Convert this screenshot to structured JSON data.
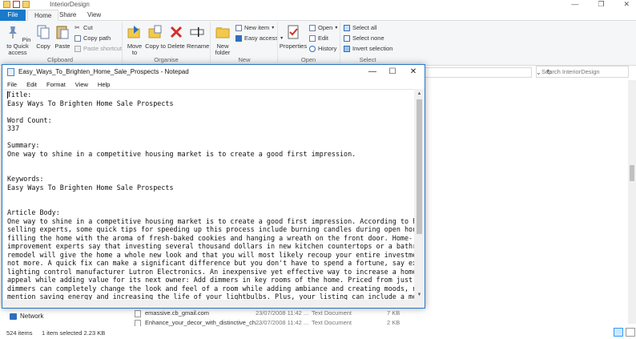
{
  "explorer": {
    "window_title": "InteriorDesign",
    "tabs": [
      "File",
      "Home",
      "Share",
      "View"
    ],
    "ribbon": {
      "clipboard": {
        "pin_label": "Pin to Quick access",
        "copy_label": "Copy",
        "paste_label": "Paste",
        "cut_label": "Cut",
        "copy_path_label": "Copy path",
        "paste_shortcut_label": "Paste shortcut",
        "group_label": "Clipboard"
      },
      "organise": {
        "move_to_label": "Move to",
        "copy_to_label": "Copy to",
        "delete_label": "Delete",
        "rename_label": "Rename",
        "group_label": "Organise"
      },
      "new": {
        "new_folder_label": "New folder",
        "new_item_label": "New item",
        "easy_access_label": "Easy access",
        "group_label": "New"
      },
      "open": {
        "properties_label": "Properties",
        "open_label": "Open",
        "edit_label": "Edit",
        "history_label": "History",
        "group_label": "Open"
      },
      "select": {
        "select_all_label": "Select all",
        "select_none_label": "Select none",
        "invert_label": "Invert selection",
        "group_label": "Select"
      }
    },
    "search_placeholder": "Search InteriorDesign",
    "nav_network": "Network",
    "files": [
      {
        "name": "emassive.cb_gmail.com",
        "date": "23/07/2008 11:42 ...",
        "type": "Text Document",
        "size": "7 KB"
      },
      {
        "name": "Enhance_your_decor_with_distinctive_ch...",
        "date": "23/07/2008 11:42 ...",
        "type": "Text Document",
        "size": "2 KB"
      }
    ],
    "status": {
      "item_count": "524 items",
      "selection": "1 item selected  2.23 KB"
    }
  },
  "notepad": {
    "title": "Easy_Ways_To_Brighten_Home_Sale_Prospects - Notepad",
    "menu": [
      "File",
      "Edit",
      "Format",
      "View",
      "Help"
    ],
    "content": "Title:\nEasy Ways To Brighten Home Sale Prospects\n\nWord Count:\n337\n\nSummary:\nOne way to shine in a competitive housing market is to create a good first impression.\n\n\nKeywords:\nEasy Ways To Brighten Home Sale Prospects\n\n\nArticle Body:\nOne way to shine in a competitive housing market is to create a good first impression. According to home-\nselling experts, some quick tips for speeding up this process include burning candles during open houses,\nfilling the home with the aroma of fresh-baked cookies and hanging a wreath on the front door. Home-\nimprovement experts say that investing several thousand dollars in new kitchen countertops or a bathroom\nremodel will give the home a whole new look and that you will most likely recoup your entire investment, if\nnot more. A quick fix can make a significant difference but you don't have to spend a fortune, say experts at\nlighting control manufacturer Lutron Electronics. An inexpensive yet effective way to increase a home's curb\nappeal while adding value for its next owner: Add dimmers in key rooms of the home. Priced from just $10,\ndimmers can completely change the look and feel of a room while adding ambiance and creating moods, not to\nmention saving energy and increasing the life of your lightbulbs. Plus, your listing can include a mention of"
  },
  "colors": {
    "accent": "#1979ca",
    "window_border": "#2a78c8"
  }
}
